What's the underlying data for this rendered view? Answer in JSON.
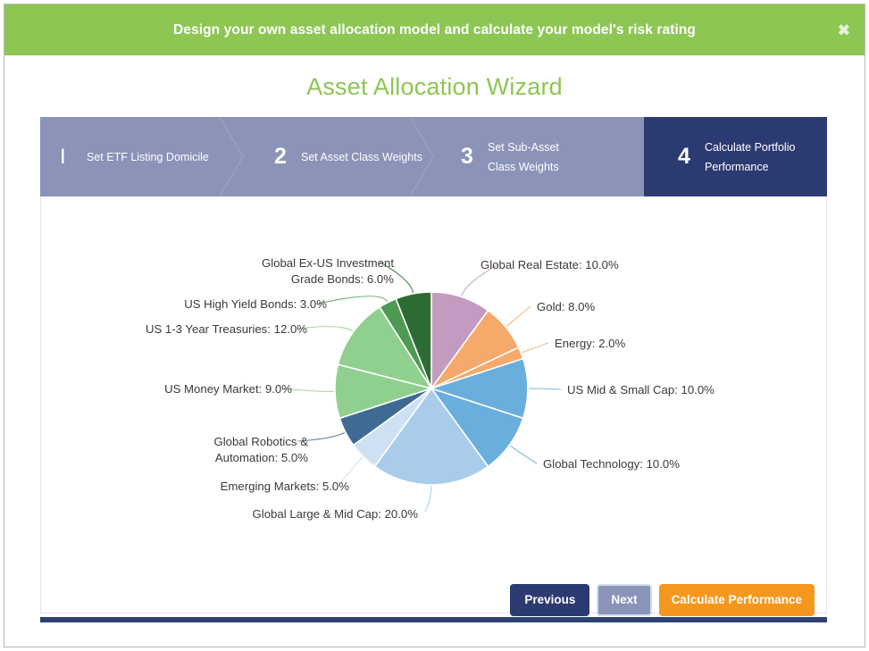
{
  "banner": {
    "message": "Design your own asset allocation model and calculate your model's risk rating",
    "close_glyph": "✖"
  },
  "page_title": "Asset Allocation Wizard",
  "steps": [
    {
      "number": "I",
      "label": "Set ETF Listing Domicile",
      "state": "inactive"
    },
    {
      "number": "2",
      "label": "Set Asset Class Weights",
      "state": "inactive"
    },
    {
      "number": "3",
      "label": "Set Sub-Asset Class Weights",
      "state": "inactive"
    },
    {
      "number": "4",
      "label": "Calculate Portfolio Performance",
      "state": "active"
    }
  ],
  "buttons": {
    "previous": "Previous",
    "next": "Next",
    "calculate": "Calculate Performance"
  },
  "colors": {
    "banner_green": "#8dc653",
    "title_green": "#8dc653",
    "step_inactive": "#8b93b8",
    "step_active": "#2c3a72",
    "accent_orange": "#f6971d",
    "bottom_bar": "#2e4272"
  },
  "chart_data": {
    "type": "pie",
    "title": "",
    "start_angle": 0,
    "direction": "clockwise",
    "label_format": "{name}: {value}%",
    "legend": "none",
    "categories": [
      "Global Real Estate",
      "Gold",
      "Energy",
      "US Mid & Small Cap",
      "Global Technology",
      "Global Large & Mid Cap",
      "Emerging Markets",
      "Global Robotics & Automation",
      "US Money Market",
      "US 1-3 Year Treasuries",
      "US High Yield Bonds",
      "Global Ex-US Investment Grade Bonds"
    ],
    "values": [
      10.0,
      8.0,
      2.0,
      10.0,
      10.0,
      20.0,
      5.0,
      5.0,
      9.0,
      12.0,
      3.0,
      6.0
    ],
    "value_labels": [
      "Global Real Estate: 10.0%",
      "Gold: 8.0%",
      "Energy: 2.0%",
      "US Mid & Small Cap: 10.0%",
      "Global Technology: 10.0%",
      "Global Large & Mid Cap: 20.0%",
      "Emerging Markets: 5.0%",
      "Global Robotics & Automation: 5.0%",
      "US Money Market: 9.0%",
      "US 1-3 Year Treasuries: 12.0%",
      "US High Yield Bonds: 3.0%",
      "Global Ex-US Investment Grade Bonds: 6.0%"
    ],
    "colors": [
      "#c39bc0",
      "#f5a96a",
      "#f5a96a",
      "#6aaedd",
      "#6aaedd",
      "#a8cce9",
      "#cfe0f2",
      "#3f6a93",
      "#90d08f",
      "#90d08f",
      "#4e9a52",
      "#2e6b34"
    ],
    "labels_lines": {
      "global_ex_us_l1": "Global Ex-US Investment",
      "global_ex_us_l2": "Grade Bonds: 6.0%",
      "robotics_l1": "Global Robotics &",
      "robotics_l2": "Automation: 5.0%"
    }
  }
}
